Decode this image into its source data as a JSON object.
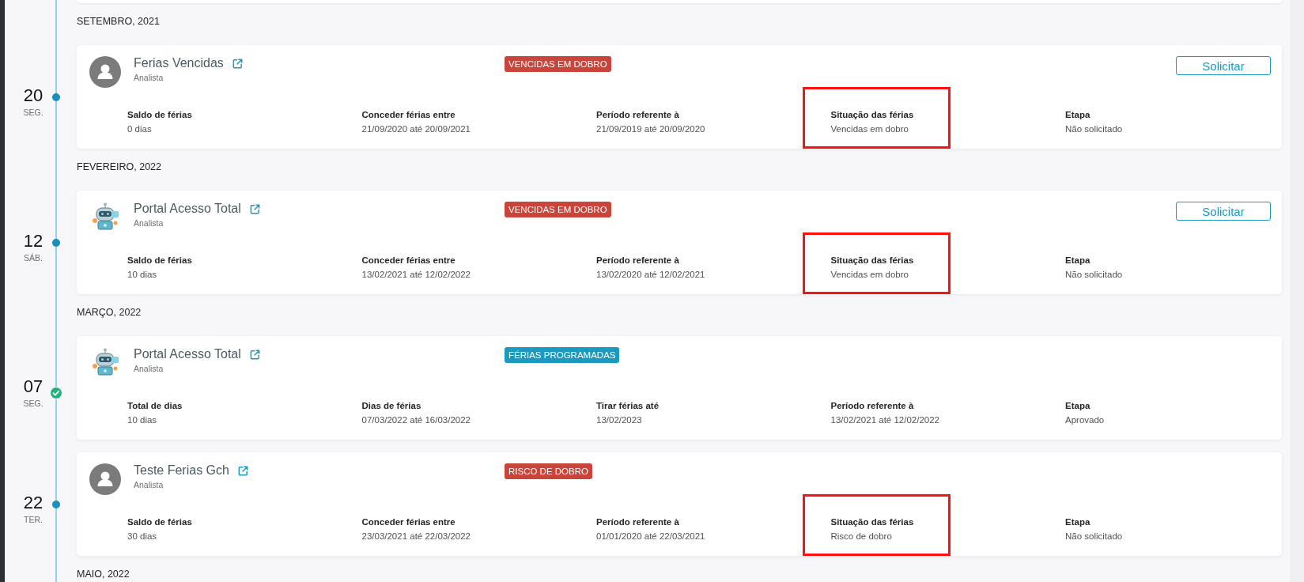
{
  "groups": [
    {
      "month": "SETEMBRO, 2021",
      "entries": [
        {
          "day": "20",
          "weekday": "SEG.",
          "approved": false,
          "custom_avatar": false,
          "name": "Ferias Vencidas",
          "role": "Analista",
          "badge": {
            "text": "VENCIDAS EM DOBRO",
            "color": "#c9453c"
          },
          "action": "Solicitar",
          "fields": [
            {
              "label": "Saldo de férias",
              "value": "0 dias",
              "highlighted": false
            },
            {
              "label": "Conceder férias entre",
              "value": "21/09/2020 até 20/09/2021",
              "highlighted": false
            },
            {
              "label": "Período referente à",
              "value": "21/09/2019 até 20/09/2020",
              "highlighted": false
            },
            {
              "label": "Situação das férias",
              "value": "Vencidas em dobro",
              "highlighted": true
            },
            {
              "label": "Etapa",
              "value": "Não solicitado",
              "highlighted": false
            }
          ]
        }
      ]
    },
    {
      "month": "FEVEREIRO, 2022",
      "entries": [
        {
          "day": "12",
          "weekday": "SÁB.",
          "approved": false,
          "custom_avatar": true,
          "name": "Portal Acesso Total",
          "role": "Analista",
          "badge": {
            "text": "VENCIDAS EM DOBRO",
            "color": "#c9453c"
          },
          "action": "Solicitar",
          "fields": [
            {
              "label": "Saldo de férias",
              "value": "10 dias",
              "highlighted": false
            },
            {
              "label": "Conceder férias entre",
              "value": "13/02/2021 até 12/02/2022",
              "highlighted": false
            },
            {
              "label": "Período referente à",
              "value": "13/02/2020 até 12/02/2021",
              "highlighted": false
            },
            {
              "label": "Situação das férias",
              "value": "Vencidas em dobro",
              "highlighted": true
            },
            {
              "label": "Etapa",
              "value": "Não solicitado",
              "highlighted": false
            }
          ]
        }
      ]
    },
    {
      "month": "MARÇO, 2022",
      "entries": [
        {
          "day": "07",
          "weekday": "SEG.",
          "approved": true,
          "custom_avatar": true,
          "name": "Portal Acesso Total",
          "role": "Analista",
          "badge": {
            "text": "FÉRIAS PROGRAMADAS",
            "color": "#1a9ac0"
          },
          "fields": [
            {
              "label": "Total de dias",
              "value": "10 dias",
              "highlighted": false
            },
            {
              "label": "Dias de férias",
              "value": "07/03/2022 até 16/03/2022",
              "highlighted": false
            },
            {
              "label": "Tirar férias até",
              "value": "13/02/2023",
              "highlighted": false
            },
            {
              "label": "Período referente à",
              "value": "13/02/2021 até 12/02/2022",
              "highlighted": false
            },
            {
              "label": "Etapa",
              "value": "Aprovado",
              "highlighted": false
            }
          ]
        },
        {
          "day": "22",
          "weekday": "TER.",
          "approved": false,
          "custom_avatar": false,
          "name": "Teste Ferias Gch",
          "role": "Analista",
          "badge": {
            "text": "RISCO DE DOBRO",
            "color": "#c9453c"
          },
          "fields": [
            {
              "label": "Saldo de férias",
              "value": "30 dias",
              "highlighted": false
            },
            {
              "label": "Conceder férias entre",
              "value": "23/03/2021 até 22/03/2022",
              "highlighted": false
            },
            {
              "label": "Período referente à",
              "value": "01/01/2020 até 22/03/2021",
              "highlighted": false
            },
            {
              "label": "Situação das férias",
              "value": "Risco de dobro",
              "highlighted": true
            },
            {
              "label": "Etapa",
              "value": "Não solicitado",
              "highlighted": false
            }
          ]
        }
      ]
    },
    {
      "month": "MAIO, 2022"
    }
  ]
}
